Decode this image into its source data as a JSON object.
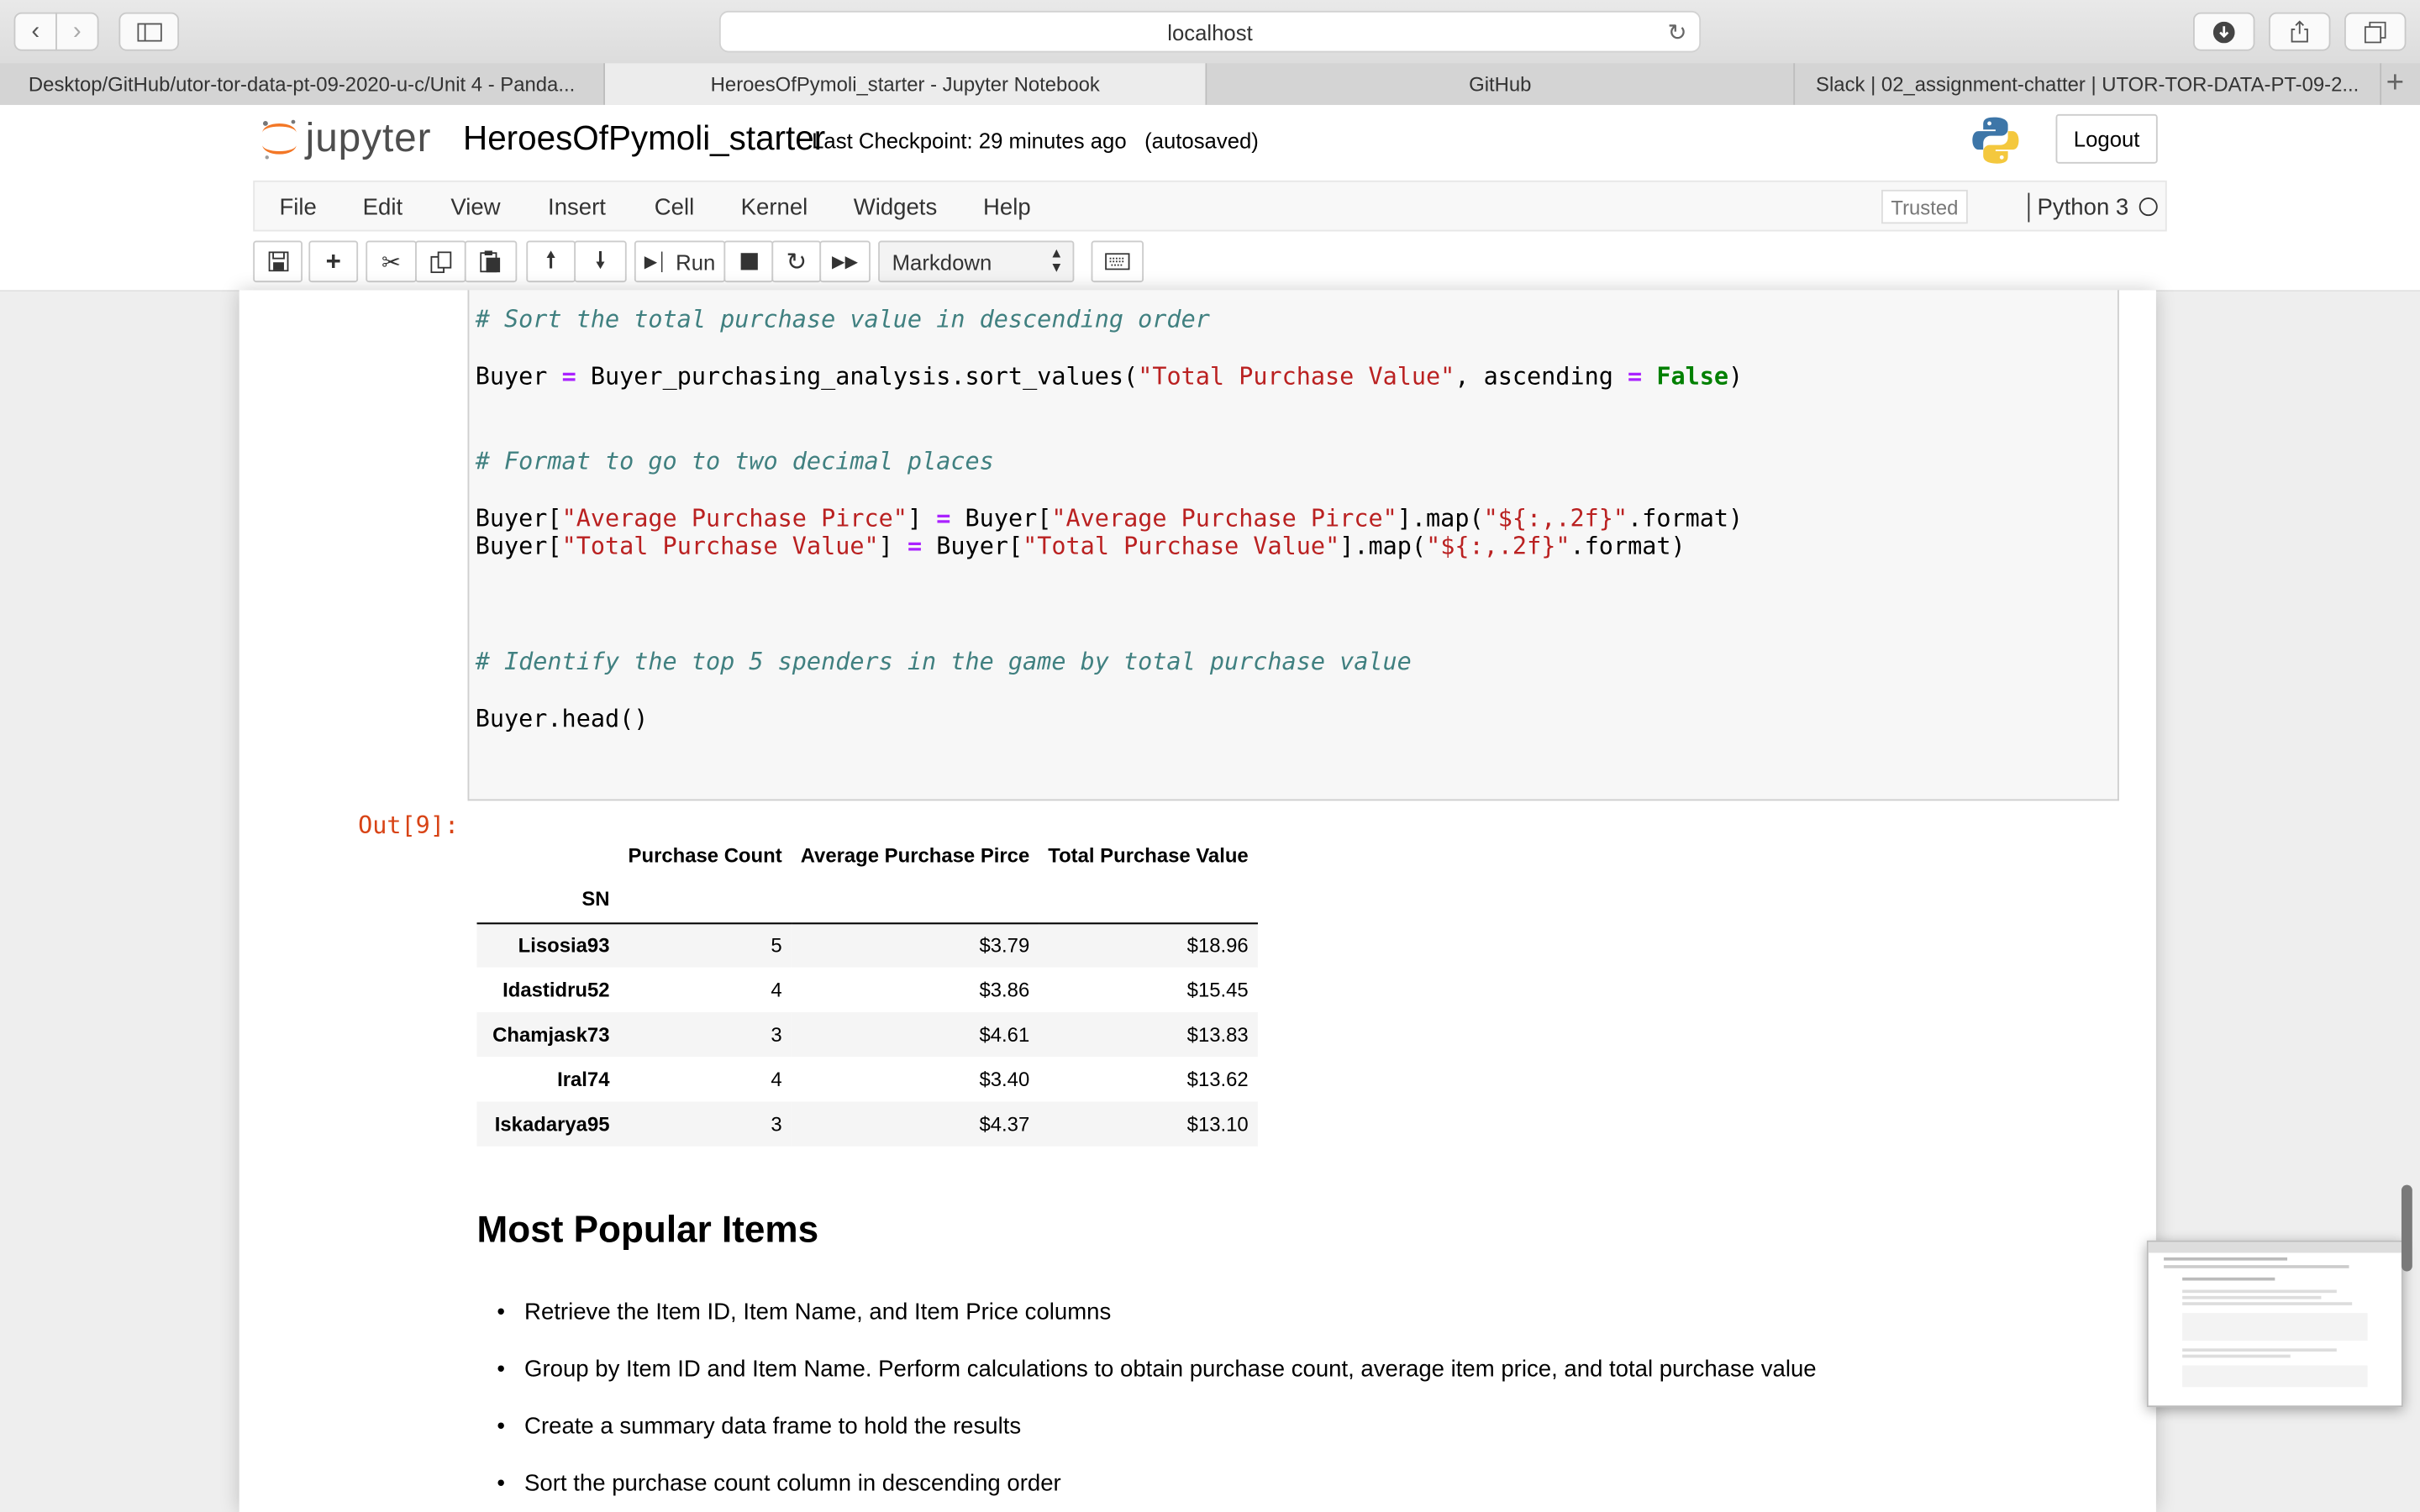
{
  "browser": {
    "address": "localhost",
    "tabs": [
      {
        "label": "Desktop/GitHub/utor-tor-data-pt-09-2020-u-c/Unit 4 - Panda..."
      },
      {
        "label": "HeroesOfPymoli_starter - Jupyter Notebook"
      },
      {
        "label": "GitHub"
      },
      {
        "label": "Slack | 02_assignment-chatter | UTOR-TOR-DATA-PT-09-2..."
      }
    ]
  },
  "jupyter": {
    "logo_text": "jupyter",
    "notebook_name": "HeroesOfPymoli_starter",
    "checkpoint": "Last Checkpoint: 29 minutes ago",
    "autosave": "(autosaved)",
    "logout_label": "Logout",
    "menus": [
      "File",
      "Edit",
      "View",
      "Insert",
      "Cell",
      "Kernel",
      "Widgets",
      "Help"
    ],
    "trusted_label": "Trusted",
    "kernel_name": "Python 3",
    "run_label": "Run",
    "cell_type": "Markdown"
  },
  "cell": {
    "comment1": "# Sort the total purchase value in descending order",
    "comment2": "# Format to go to two decimal places",
    "comment3": "# Identify the top 5 spenders in the game by total purchase value",
    "head_call": "Buyer.head()",
    "out_prompt": "Out[9]:"
  },
  "table": {
    "columns": [
      "Purchase Count",
      "Average Purchase Pirce",
      "Total Purchase Value"
    ],
    "index_name": "SN",
    "rows": [
      {
        "sn": "Lisosia93",
        "count": "5",
        "avg": "$3.79",
        "total": "$18.96"
      },
      {
        "sn": "Idastidru52",
        "count": "4",
        "avg": "$3.86",
        "total": "$15.45"
      },
      {
        "sn": "Chamjask73",
        "count": "3",
        "avg": "$4.61",
        "total": "$13.83"
      },
      {
        "sn": "Iral74",
        "count": "4",
        "avg": "$3.40",
        "total": "$13.62"
      },
      {
        "sn": "Iskadarya95",
        "count": "3",
        "avg": "$4.37",
        "total": "$13.10"
      }
    ]
  },
  "markdown": {
    "heading": "Most Popular Items",
    "bullets": [
      "Retrieve the Item ID, Item Name, and Item Price columns",
      "Group by Item ID and Item Name. Perform calculations to obtain purchase count, average item price, and total purchase value",
      "Create a summary data frame to hold the results",
      "Sort the purchase count column in descending order"
    ]
  }
}
